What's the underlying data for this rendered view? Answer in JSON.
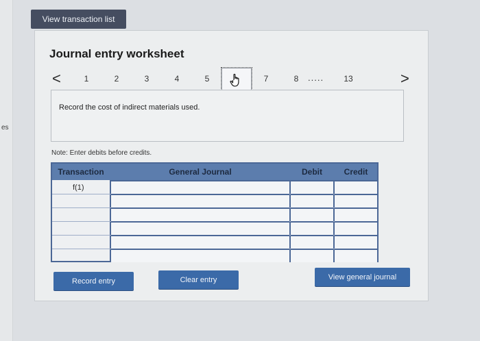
{
  "sidebar": {
    "text": "es"
  },
  "toolbar": {
    "view_transactions_label": "View transaction list"
  },
  "worksheet": {
    "title": "Journal entry worksheet",
    "pager": {
      "prev_label": "<",
      "next_label": ">",
      "pages": [
        "1",
        "2",
        "3",
        "4",
        "5",
        "7",
        "8"
      ],
      "current_page_icon": "hand-pointer-icon",
      "ellipsis": ".....",
      "last_page": "13"
    },
    "instruction": "Record the cost of indirect materials used.",
    "note": "Note: Enter debits before credits.",
    "table": {
      "headers": [
        "Transaction",
        "General Journal",
        "Debit",
        "Credit"
      ],
      "rows": [
        {
          "transaction": "f(1)",
          "general_journal": "",
          "debit": "",
          "credit": ""
        },
        {
          "transaction": "",
          "general_journal": "",
          "debit": "",
          "credit": ""
        },
        {
          "transaction": "",
          "general_journal": "",
          "debit": "",
          "credit": ""
        },
        {
          "transaction": "",
          "general_journal": "",
          "debit": "",
          "credit": ""
        },
        {
          "transaction": "",
          "general_journal": "",
          "debit": "",
          "credit": ""
        },
        {
          "transaction": "",
          "general_journal": "",
          "debit": "",
          "credit": ""
        }
      ]
    },
    "buttons": {
      "record_entry": "Record entry",
      "clear_entry": "Clear entry",
      "view_general_journal": "View general journal"
    }
  },
  "colors": {
    "panel_bg": "#eceeef",
    "header_blue": "#5c7dad",
    "button_blue": "#3b6aa8",
    "dark_button": "#454d60"
  }
}
